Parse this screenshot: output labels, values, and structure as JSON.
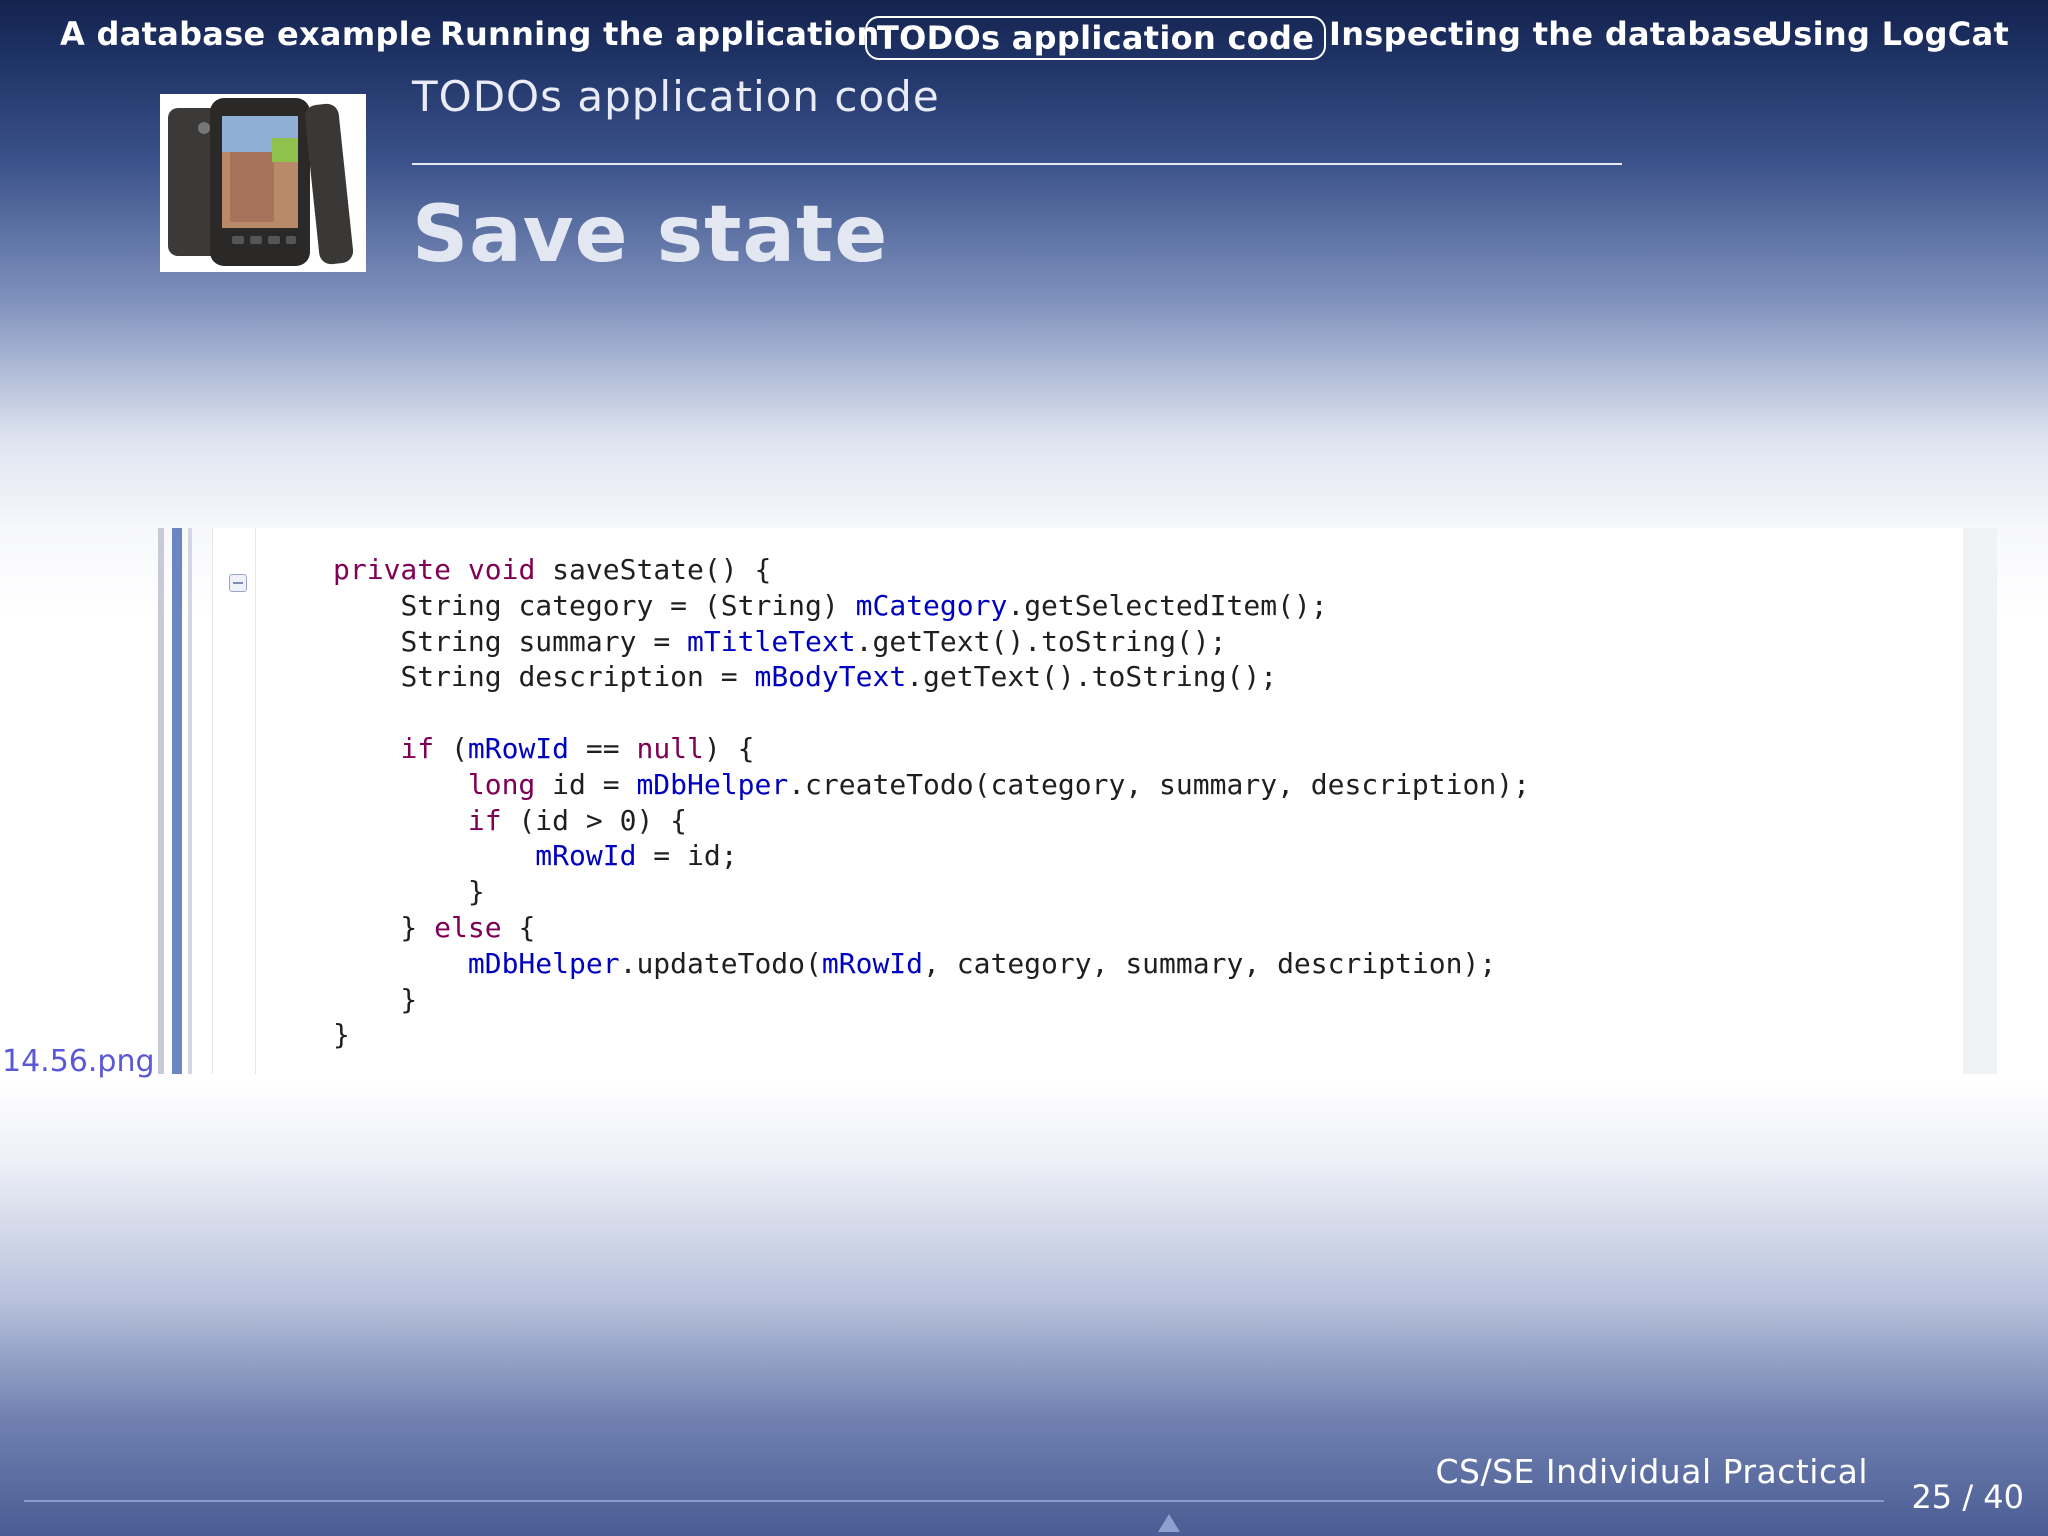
{
  "nav": {
    "items": [
      {
        "label": "A database example"
      },
      {
        "label": "Running the application"
      },
      {
        "label": "TODOs application code",
        "active": true
      },
      {
        "label": "Inspecting the database"
      },
      {
        "label": "Using LogCat"
      }
    ]
  },
  "logo": {
    "icon": "htc-phone-image"
  },
  "header": {
    "section_title": "TODOs application code",
    "frame_title": "Save state"
  },
  "code": {
    "lines": [
      "private void saveState() {",
      "    String category = (String) mCategory.getSelectedItem();",
      "    String summary = mTitleText.getText().toString();",
      "    String description = mBodyText.getText().toString();",
      "",
      "    if (mRowId == null) {",
      "        long id = mDbHelper.createTodo(category, summary, description);",
      "        if (id > 0) {",
      "            mRowId = id;",
      "        }",
      "    } else {",
      "        mDbHelper.updateTodo(mRowId, category, summary, description);",
      "    }",
      "}"
    ],
    "keyword_color": "#7f0055",
    "field_color": "#0000c0"
  },
  "image_caption": "14.56.png",
  "footer": {
    "title": "CS/SE Individual Practical",
    "page": "25 / 40"
  }
}
